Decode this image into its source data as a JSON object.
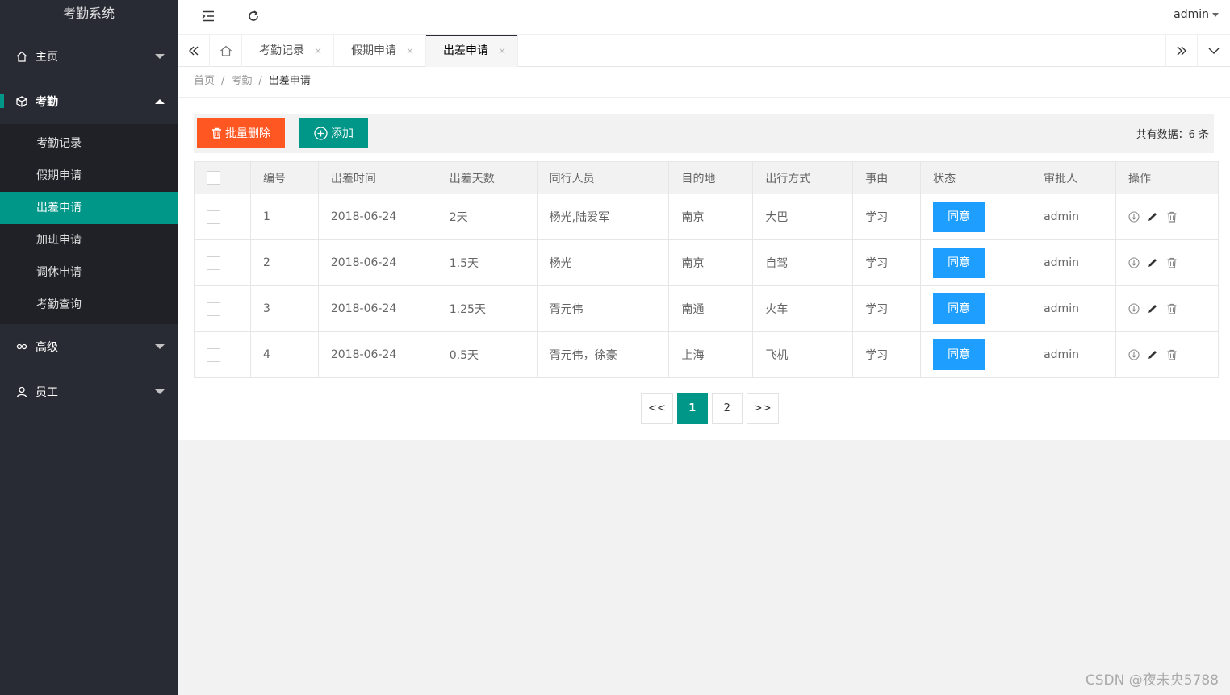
{
  "app": {
    "title": "考勤系统"
  },
  "header": {
    "user": "admin",
    "collapse_icon": "menu-fold-icon",
    "refresh_icon": "refresh-icon"
  },
  "sidebar": {
    "items": [
      {
        "label": "主页",
        "icon": "home-icon"
      },
      {
        "label": "考勤",
        "icon": "cube-icon",
        "open": true,
        "children": [
          {
            "label": "考勤记录"
          },
          {
            "label": "假期申请"
          },
          {
            "label": "出差申请",
            "active": true
          },
          {
            "label": "加班申请"
          },
          {
            "label": "调休申请"
          },
          {
            "label": "考勤查询"
          }
        ]
      },
      {
        "label": "高级",
        "icon": "link-icon"
      },
      {
        "label": "员工",
        "icon": "user-icon"
      }
    ]
  },
  "tabs": [
    {
      "label": "考勤记录"
    },
    {
      "label": "假期申请"
    },
    {
      "label": "出差申请",
      "active": true
    }
  ],
  "breadcrumb": {
    "home": "首页",
    "section": "考勤",
    "current": "出差申请",
    "sep": "/"
  },
  "toolbar": {
    "batch_delete": "批量删除",
    "add": "添加",
    "total_label": "共有数据：6 条"
  },
  "table": {
    "columns": [
      "编号",
      "出差时间",
      "出差天数",
      "同行人员",
      "目的地",
      "出行方式",
      "事由",
      "状态",
      "审批人",
      "操作"
    ],
    "rows": [
      {
        "id": "1",
        "date": "2018-06-24",
        "days": "2天",
        "companions": "杨光,陆爱军",
        "destination": "南京",
        "transport": "大巴",
        "reason": "学习",
        "status": "同意",
        "approver": "admin"
      },
      {
        "id": "2",
        "date": "2018-06-24",
        "days": "1.5天",
        "companions": "杨光",
        "destination": "南京",
        "transport": "自驾",
        "reason": "学习",
        "status": "同意",
        "approver": "admin"
      },
      {
        "id": "3",
        "date": "2018-06-24",
        "days": "1.25天",
        "companions": "胥元伟",
        "destination": "南通",
        "transport": "火车",
        "reason": "学习",
        "status": "同意",
        "approver": "admin"
      },
      {
        "id": "4",
        "date": "2018-06-24",
        "days": "0.5天",
        "companions": "胥元伟，徐豪",
        "destination": "上海",
        "transport": "飞机",
        "reason": "学习",
        "status": "同意",
        "approver": "admin"
      }
    ]
  },
  "pagination": {
    "prev": "<<",
    "pages": [
      "1",
      "2"
    ],
    "current": "1",
    "next": ">>"
  },
  "watermark": "CSDN @夜未央5788",
  "colors": {
    "sidebar": "#282b33",
    "accent": "#009688",
    "danger": "#ff5722",
    "agree": "#1e9fff"
  }
}
